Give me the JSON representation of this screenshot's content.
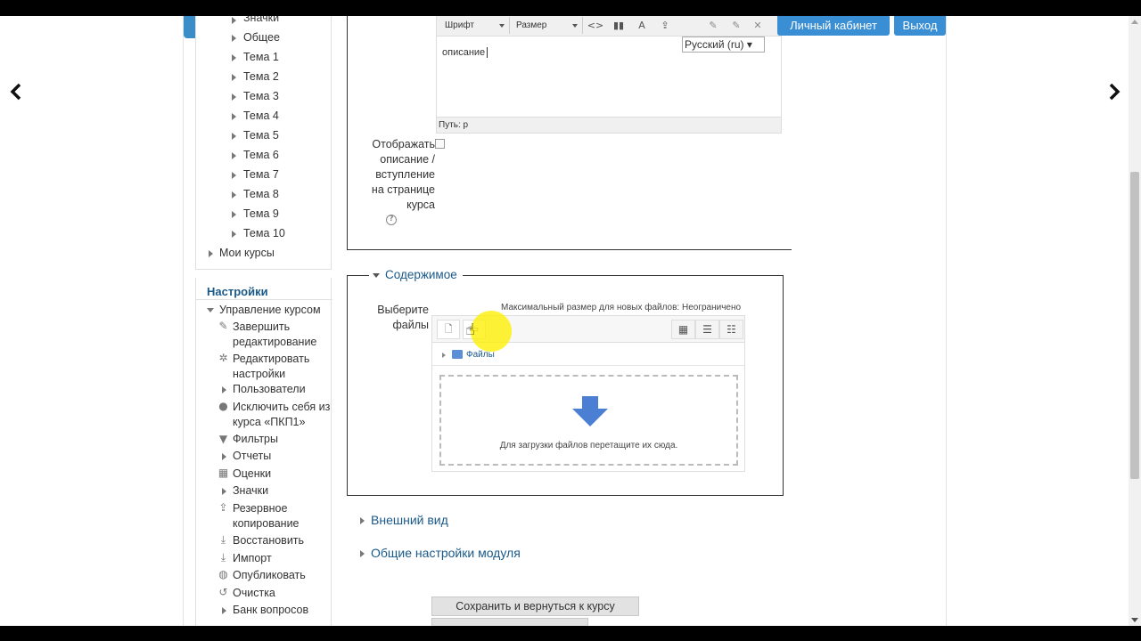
{
  "top_nav": {
    "cabinet_label": "Личный кабинет",
    "logout_label": "Выход"
  },
  "nav_tree": {
    "items": [
      "Значки",
      "Общее",
      "Тема 1",
      "Тема 2",
      "Тема 3",
      "Тема 4",
      "Тема 5",
      "Тема 6",
      "Тема 7",
      "Тема 8",
      "Тема 9",
      "Тема 10"
    ],
    "my_courses": "Мои курсы"
  },
  "settings": {
    "title": "Настройки",
    "course_admin": "Управление курсом",
    "items": [
      {
        "icon": "pencil-icon",
        "label": "Завершить редактирование"
      },
      {
        "icon": "gear-icon",
        "label": "Редактировать настройки"
      },
      {
        "icon": "triangle-icon",
        "label": "Пользователи"
      },
      {
        "icon": "user-icon",
        "label": "Исключить себя из курса «ПКП1»"
      },
      {
        "icon": "filter-icon",
        "label": "Фильтры"
      },
      {
        "icon": "triangle-icon",
        "label": "Отчеты"
      },
      {
        "icon": "table-icon",
        "label": "Оценки"
      },
      {
        "icon": "triangle-icon",
        "label": "Значки"
      },
      {
        "icon": "backup-icon",
        "label": "Резервное копирование"
      },
      {
        "icon": "restore-icon",
        "label": "Восстановить"
      },
      {
        "icon": "import-icon",
        "label": "Импорт"
      },
      {
        "icon": "publish-icon",
        "label": "Опубликовать"
      },
      {
        "icon": "reset-icon",
        "label": "Очистка"
      },
      {
        "icon": "triangle-icon",
        "label": "Банк вопросов"
      }
    ]
  },
  "editor": {
    "font_label": "Шрифт",
    "size_label": "Размер",
    "language": "Русский (ru)",
    "content": "описание",
    "path_label": "Путь: p"
  },
  "display_description": {
    "label": "Отображать описание / вступление на странице курса"
  },
  "content_section": {
    "legend": "Содержимое",
    "choose_files_label": "Выберите файлы",
    "max_size_text": "Максимальный размер для новых файлов: Неограничено",
    "folder_label": "Файлы",
    "drop_hint": "Для загрузки файлов перетащите их сюда."
  },
  "collapsed_sections": {
    "appearance": "Внешний вид",
    "module_settings": "Общие настройки модуля"
  },
  "buttons": {
    "save_return": "Сохранить и вернуться к курсу"
  },
  "colors": {
    "accent": "#3a8ed3",
    "section_title": "#1a5a8a",
    "drop_arrow": "#4a7fd4",
    "cursor_highlight": "#fff000"
  }
}
